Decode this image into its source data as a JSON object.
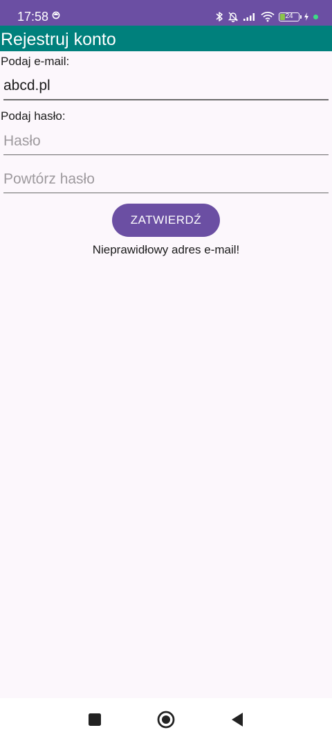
{
  "status_bar": {
    "time": "17:58",
    "battery_level": "24",
    "battery_fraction": 0.24,
    "icons": [
      "sync-icon",
      "bluetooth-icon",
      "muted-bell-icon",
      "signal-icon",
      "wifi-icon",
      "battery-icon",
      "charging-icon"
    ]
  },
  "app_bar": {
    "title": "Rejestruj konto",
    "color": "#00807c"
  },
  "form": {
    "email_label": "Podaj e-mail:",
    "email_value": "abcd.pl",
    "password_label": "Podaj hasło:",
    "password_placeholder": "Hasło",
    "repeat_password_placeholder": "Powtórz hasło",
    "submit_label": "ZATWIERDŹ",
    "error_message": "Nieprawidłowy adres e-mail!"
  },
  "nav_bar": {
    "icons": [
      "recents-square-icon",
      "home-circle-icon",
      "back-triangle-icon"
    ]
  },
  "colors": {
    "accent": "#6b4fa3",
    "app_bar": "#00807c",
    "background": "#fcf7fc"
  }
}
